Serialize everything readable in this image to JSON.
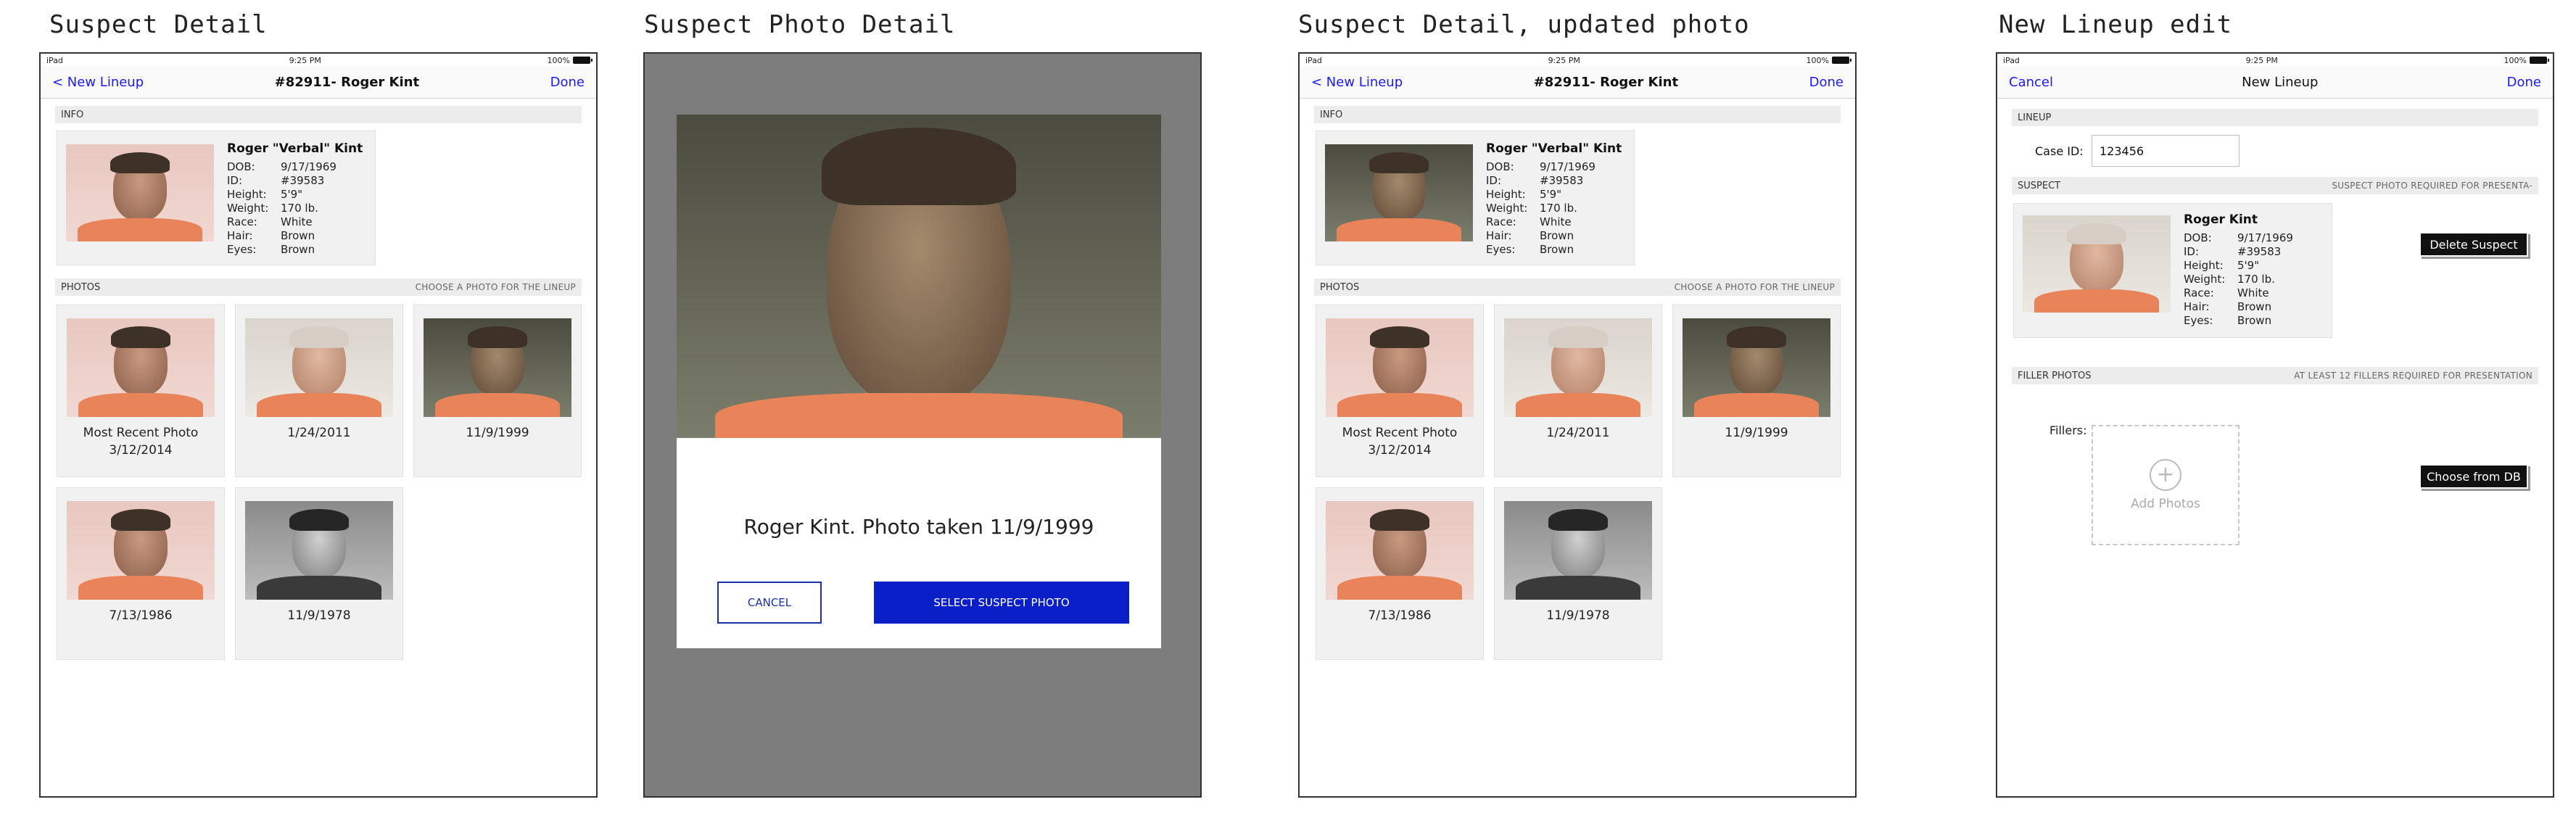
{
  "screens": [
    {
      "title": "Suspect Detail"
    },
    {
      "title": "Suspect Photo Detail"
    },
    {
      "title": "Suspect Detail, updated photo"
    },
    {
      "title": "New Lineup edit"
    }
  ],
  "status": {
    "device": "iPad",
    "time": "9:25 PM",
    "battery": "100%"
  },
  "detail": {
    "back_label": "< New Lineup",
    "title": "#82911- Roger Kint",
    "done_label": "Done",
    "info_header": "INFO",
    "photos_header": "PHOTOS",
    "photos_hint": "CHOOSE A PHOTO FOR THE LINEUP"
  },
  "suspect": {
    "full_name": "Roger \"Verbal\" Kint",
    "short_name": "Roger Kint",
    "fields": [
      {
        "label": "DOB:",
        "value": "9/17/1969"
      },
      {
        "label": "ID:",
        "value": "#39583"
      },
      {
        "label": "Height:",
        "value": "5'9\""
      },
      {
        "label": "Weight:",
        "value": "170 lb."
      },
      {
        "label": "Race:",
        "value": "White"
      },
      {
        "label": "Hair:",
        "value": "Brown"
      },
      {
        "label": "Eyes:",
        "value": "Brown"
      }
    ]
  },
  "photos": [
    {
      "caption": "Most Recent Photo\n3/12/2014"
    },
    {
      "caption": "1/24/2011"
    },
    {
      "caption": "11/9/1999"
    },
    {
      "caption": "7/13/1986"
    },
    {
      "caption": "11/9/1978"
    }
  ],
  "modal": {
    "caption": "Roger Kint. Photo taken 11/9/1999",
    "cancel_label": "CANCEL",
    "select_label": "SELECT SUSPECT PHOTO"
  },
  "lineup": {
    "cancel_label": "Cancel",
    "title": "New Lineup",
    "done_label": "Done",
    "lineup_header": "LINEUP",
    "case_label": "Case ID:",
    "case_value": "123456",
    "suspect_header": "SUSPECT",
    "suspect_hint": "SUSPECT PHOTO REQUIRED FOR PRESENTA-",
    "delete_label": "Delete Suspect",
    "filler_header": "FILLER PHOTOS",
    "filler_hint": "AT LEAST 12 FILLERS REQUIRED FOR PRESENTATION",
    "fillers_label": "Fillers:",
    "add_photos_label": "Add Photos",
    "choose_label": "Choose from DB"
  },
  "colors": {
    "link": "#1a1aff",
    "primary_button": "#0a1fc7",
    "dim_overlay": "#7d7d7d"
  }
}
